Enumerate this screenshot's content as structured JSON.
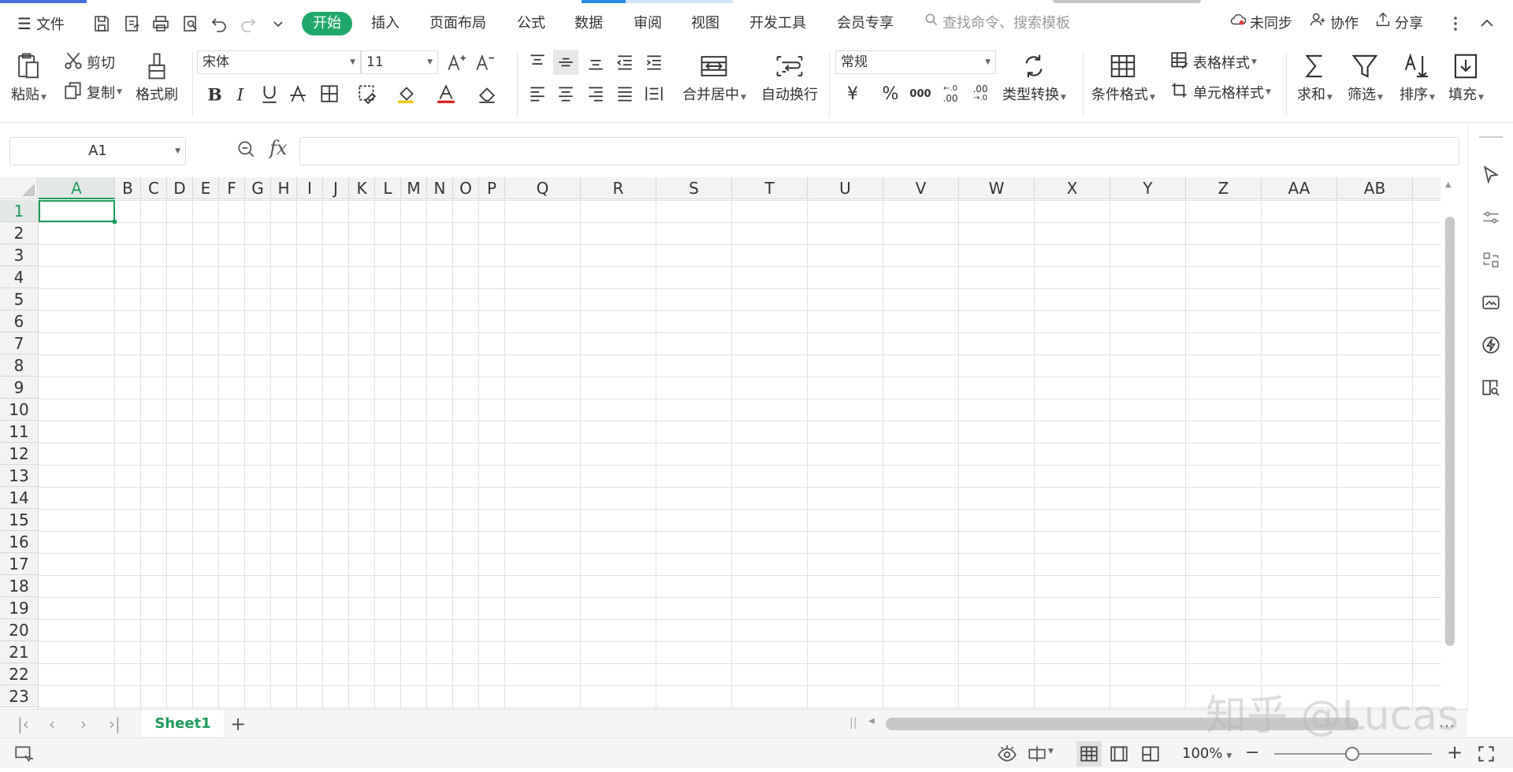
{
  "titlebar": {
    "menu_label": "文件",
    "tabs": [
      "开始",
      "插入",
      "页面布局",
      "公式",
      "数据",
      "审阅",
      "视图",
      "开发工具",
      "会员专享"
    ],
    "active_tab": "开始",
    "search_placeholder": "查找命令、搜索模板",
    "sync_label": "未同步",
    "collab_label": "协作",
    "share_label": "分享"
  },
  "ribbon": {
    "paste": "粘贴",
    "cut": "剪切",
    "copy": "复制",
    "format_painter": "格式刷",
    "font_name": "宋体",
    "font_size": "11",
    "merge_center": "合并居中",
    "wrap_text": "自动换行",
    "number_format": "常规",
    "type_convert": "类型转换",
    "conditional_format": "条件格式",
    "table_style": "表格样式",
    "cell_style": "单元格样式",
    "sum": "求和",
    "filter": "筛选",
    "sort": "排序",
    "fill": "填充",
    "currency_symbol": "¥",
    "percent_symbol": "%",
    "thousands_symbol": "000",
    "inc_decimal": ".00",
    "dec_decimal": ".00"
  },
  "formula_bar": {
    "name_box": "A1",
    "fx_label": "fx",
    "formula_value": ""
  },
  "grid": {
    "columns": [
      "A",
      "B",
      "C",
      "D",
      "E",
      "F",
      "G",
      "H",
      "I",
      "J",
      "K",
      "L",
      "M",
      "N",
      "O",
      "P",
      "Q",
      "R",
      "S",
      "T",
      "U",
      "V",
      "W",
      "X",
      "Y",
      "Z",
      "AA",
      "AB"
    ],
    "rows": [
      "1",
      "2",
      "3",
      "4",
      "5",
      "6",
      "7",
      "8",
      "9",
      "10",
      "11",
      "12",
      "13",
      "14",
      "15",
      "16",
      "17",
      "18",
      "19",
      "20",
      "21",
      "22",
      "23"
    ],
    "active_cell": "A1",
    "accent_color": "#1e9a5a"
  },
  "sheets": {
    "tabs": [
      "Sheet1"
    ],
    "add_label": "+"
  },
  "status": {
    "zoom": "100%"
  },
  "watermark": "知乎 @Lucas",
  "colors": {
    "brand": "#20a86b",
    "grid_line": "#dde1e6"
  }
}
